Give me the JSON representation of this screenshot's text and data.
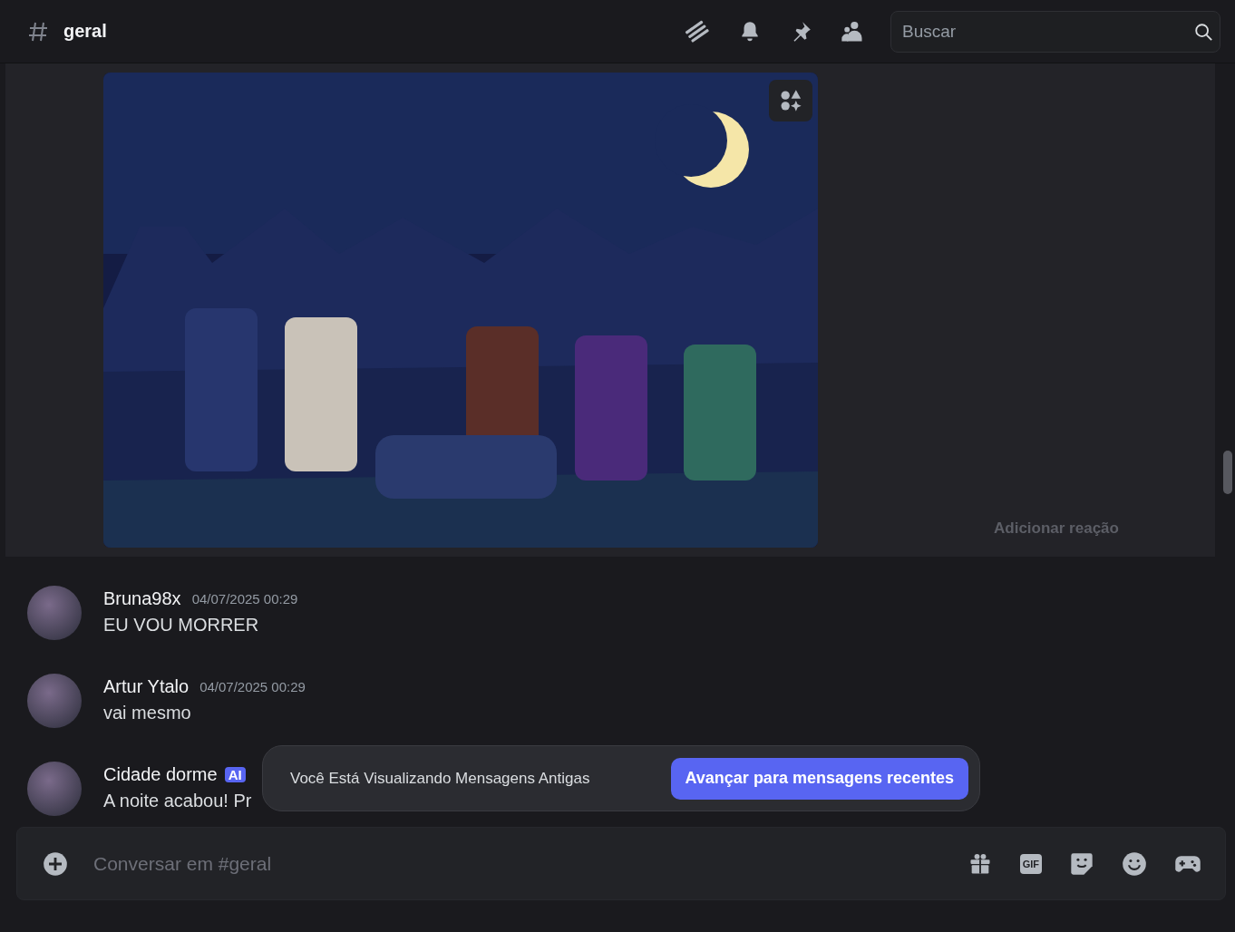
{
  "header": {
    "channel_name": "geral",
    "search": {
      "placeholder": "Buscar"
    }
  },
  "highlighted_message": {
    "reaction_hint": "Adicionar reação"
  },
  "messages": [
    {
      "author": "Bruna98x",
      "timestamp": "04/07/2025 00:29",
      "text": "EU VOU MORRER"
    },
    {
      "author": "Artur Ytalo",
      "timestamp": "04/07/2025 00:29",
      "text": "vai mesmo"
    },
    {
      "author": "Cidade dorme",
      "badge": "AI",
      "text": "A noite acabou! Pr"
    }
  ],
  "jump_bar": {
    "text": "Você Está Visualizando Mensagens Antigas",
    "button": "Avançar para mensagens recentes"
  },
  "composer": {
    "placeholder": "Conversar em #geral",
    "gif_label": "GIF"
  }
}
